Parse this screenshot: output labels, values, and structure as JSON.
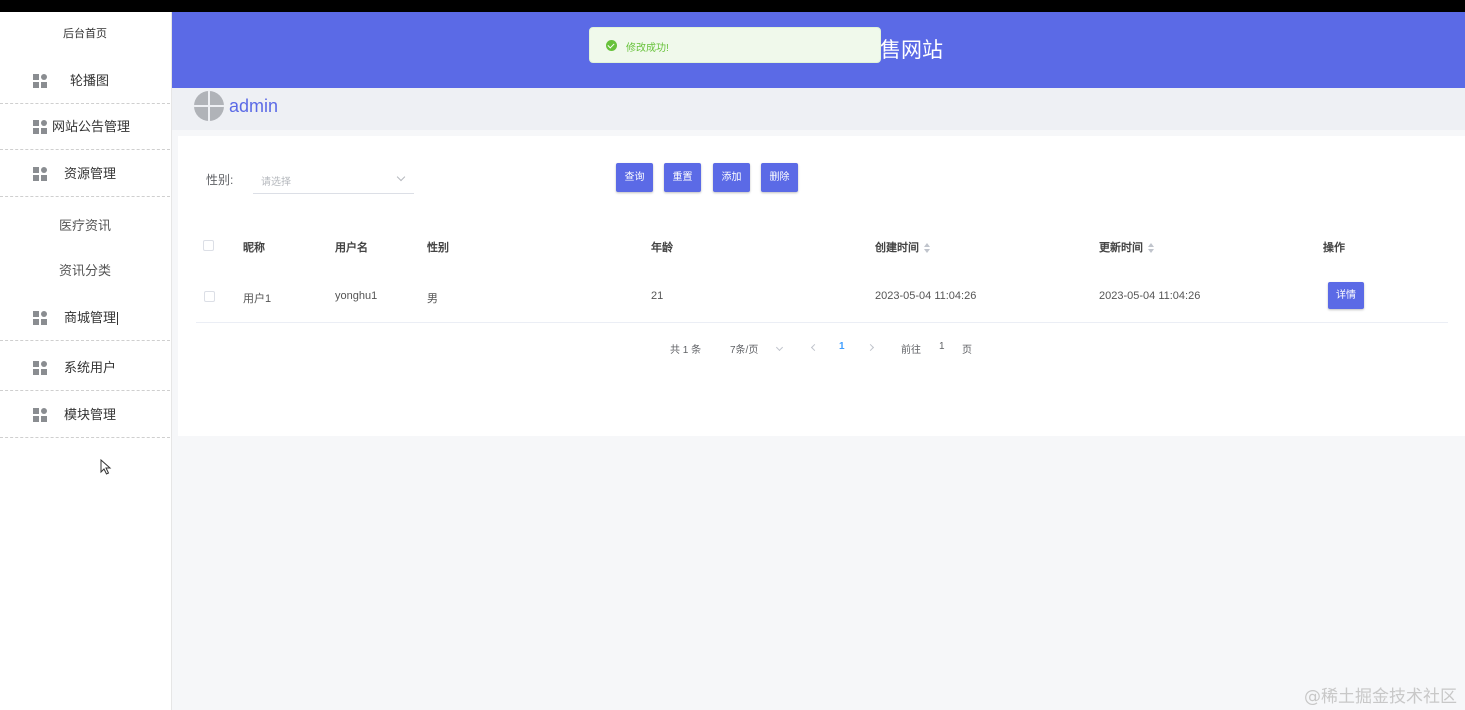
{
  "sidebar": {
    "home": "后台首页",
    "items": [
      {
        "label": "轮播图"
      },
      {
        "label": "网站公告管理"
      },
      {
        "label": "资源管理"
      },
      {
        "label": "商城管理"
      },
      {
        "label": "系统用户"
      },
      {
        "label": "模块管理"
      }
    ],
    "sub_items": [
      {
        "label": "医疗资讯"
      },
      {
        "label": "资讯分类"
      }
    ]
  },
  "header": {
    "title": "售网站"
  },
  "toast": {
    "message": "修改成功!"
  },
  "user": {
    "name": "admin"
  },
  "filter": {
    "label": "性别:",
    "placeholder": "请选择"
  },
  "buttons": {
    "query": "查询",
    "reset": "重置",
    "add": "添加",
    "delete": "删除"
  },
  "table": {
    "columns": [
      "昵称",
      "用户名",
      "性别",
      "年龄",
      "创建时间",
      "更新时间",
      "操作"
    ],
    "rows": [
      {
        "nickname": "用户1",
        "username": "yonghu1",
        "gender": "男",
        "age": "21",
        "created": "2023-05-04 11:04:26",
        "updated": "2023-05-04 11:04:26",
        "action": "详情"
      }
    ]
  },
  "pagination": {
    "total": "共 1 条",
    "page_size": "7条/页",
    "current": "1",
    "goto_prefix": "前往",
    "goto_value": "1",
    "goto_suffix": "页"
  },
  "watermark": "@稀土掘金技术社区",
  "colors": {
    "primary": "#5b6ae6",
    "success": "#67c23a"
  }
}
